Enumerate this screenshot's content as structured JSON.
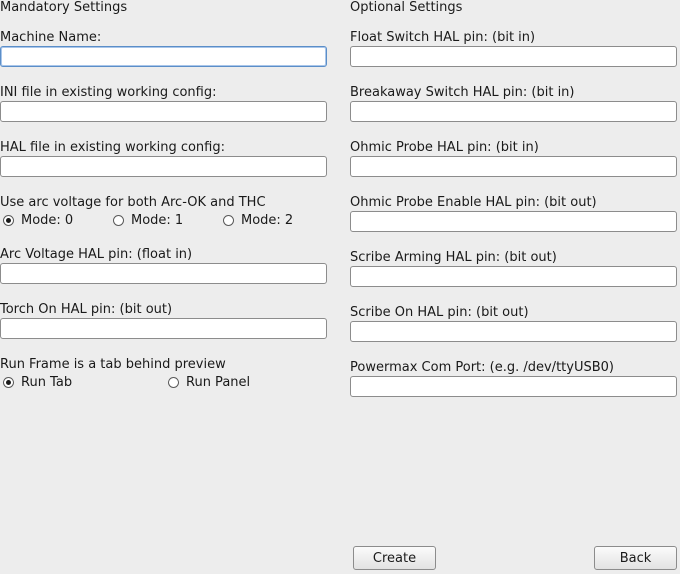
{
  "mandatory": {
    "title": "Mandatory Settings",
    "machine_name": {
      "label": "Machine Name:",
      "value": ""
    },
    "ini_file": {
      "label": "INI file in existing working config:",
      "value": ""
    },
    "hal_file": {
      "label": "HAL file in existing working config:",
      "value": ""
    },
    "arc_mode": {
      "label": "Use arc voltage for both Arc-OK and THC",
      "options": [
        "Mode: 0",
        "Mode: 1",
        "Mode: 2"
      ],
      "selected": "Mode: 0"
    },
    "arc_voltage_pin": {
      "label": "Arc Voltage HAL pin: (float in)",
      "value": ""
    },
    "torch_on_pin": {
      "label": "Torch On HAL pin: (bit out)",
      "value": ""
    },
    "run_frame": {
      "label": "Run Frame is a tab behind preview",
      "options": [
        "Run Tab",
        "Run Panel"
      ],
      "selected": "Run Tab"
    }
  },
  "optional": {
    "title": "Optional Settings",
    "float_switch_pin": {
      "label": "Float Switch HAL pin: (bit in)",
      "value": ""
    },
    "breakaway_switch_pin": {
      "label": "Breakaway Switch HAL pin: (bit in)",
      "value": ""
    },
    "ohmic_probe_pin": {
      "label": "Ohmic Probe HAL pin: (bit in)",
      "value": ""
    },
    "ohmic_probe_enable_pin": {
      "label": "Ohmic Probe Enable HAL pin: (bit out)",
      "value": ""
    },
    "scribe_arming_pin": {
      "label": "Scribe Arming HAL pin: (bit out)",
      "value": ""
    },
    "scribe_on_pin": {
      "label": "Scribe On HAL pin: (bit out)",
      "value": ""
    },
    "powermax_port": {
      "label": "Powermax Com Port: (e.g. /dev/ttyUSB0)",
      "value": ""
    }
  },
  "buttons": {
    "create": "Create",
    "back": "Back"
  }
}
